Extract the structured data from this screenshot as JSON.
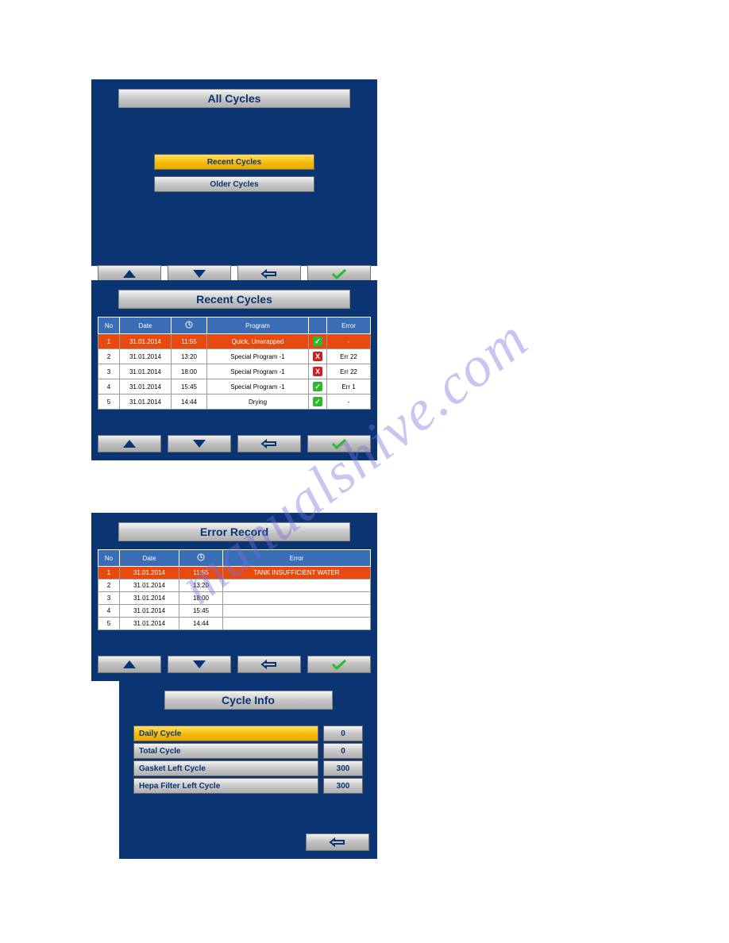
{
  "watermark": "manualshive.com",
  "panel1": {
    "title": "All Cycles",
    "options": [
      "Recent Cycles",
      "Older Cycles"
    ]
  },
  "panel2": {
    "title": "Recent Cycles",
    "headers": {
      "no": "No",
      "date": "Date",
      "time": "",
      "program": "Program",
      "status": "",
      "error": "Error"
    },
    "rows": [
      {
        "no": "1",
        "date": "31.01.2014",
        "time": "11:55",
        "program": "Quick, Unwrapped",
        "status": "ok",
        "error": "-"
      },
      {
        "no": "2",
        "date": "31.01.2014",
        "time": "13:20",
        "program": "Special Program -1",
        "status": "err",
        "error": "Err 22"
      },
      {
        "no": "3",
        "date": "31.01.2014",
        "time": "18:00",
        "program": "Special Program -1",
        "status": "err",
        "error": "Err 22"
      },
      {
        "no": "4",
        "date": "31.01.2014",
        "time": "15:45",
        "program": "Special Program -1",
        "status": "ok",
        "error": "Err 1"
      },
      {
        "no": "5",
        "date": "31.01.2014",
        "time": "14:44",
        "program": "Drying",
        "status": "ok",
        "error": "-"
      }
    ]
  },
  "panel3": {
    "title": "Error Record",
    "headers": {
      "no": "No",
      "date": "Date",
      "time": "",
      "error": "Error"
    },
    "rows": [
      {
        "no": "1",
        "date": "31.01.2014",
        "time": "11:55",
        "error": "TANK INSUFFICIENT WATER"
      },
      {
        "no": "2",
        "date": "31.01.2014",
        "time": "13:20",
        "error": ""
      },
      {
        "no": "3",
        "date": "31.01.2014",
        "time": "18:00",
        "error": ""
      },
      {
        "no": "4",
        "date": "31.01.2014",
        "time": "15:45",
        "error": ""
      },
      {
        "no": "5",
        "date": "31.01.2014",
        "time": "14:44",
        "error": ""
      }
    ]
  },
  "panel4": {
    "title": "Cycle Info",
    "rows": [
      {
        "label": "Daily Cycle",
        "value": "0",
        "selected": true
      },
      {
        "label": "Total Cycle",
        "value": "0",
        "selected": false
      },
      {
        "label": "Gasket Left Cycle",
        "value": "300",
        "selected": false
      },
      {
        "label": "Hepa Filter Left Cycle",
        "value": "300",
        "selected": false
      }
    ]
  }
}
